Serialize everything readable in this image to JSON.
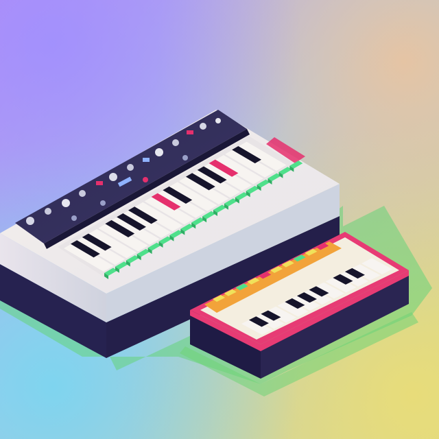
{
  "scene": {
    "objects": [
      {
        "name": "large-synthesizer",
        "white_key_count": 16,
        "pad_count": 18,
        "control_knob_count": 14
      },
      {
        "name": "small-keyboard",
        "white_key_count": 11,
        "pad_count": 10
      }
    ],
    "colors": {
      "bg_violet": "#b98df3",
      "bg_blue": "#8fd3ef",
      "bg_yellow": "#e6dc7a",
      "bg_peach": "#e8c4a2",
      "synth_top_light": "#f2ede8",
      "synth_side_light": "#dfe1e8",
      "synth_base_dark": "#262250",
      "synth_panel": "#2f2b56",
      "key_white": "#f7f4f1",
      "key_black": "#16142b",
      "pad_green": "#4fe08b",
      "accent_pink": "#e5306d",
      "small_frame_pink": "#e73b74",
      "small_stripe_orange": "#f2a33a",
      "small_pad_yellow": "#f0e15a",
      "shadow_green": "#5ecf5a"
    }
  }
}
